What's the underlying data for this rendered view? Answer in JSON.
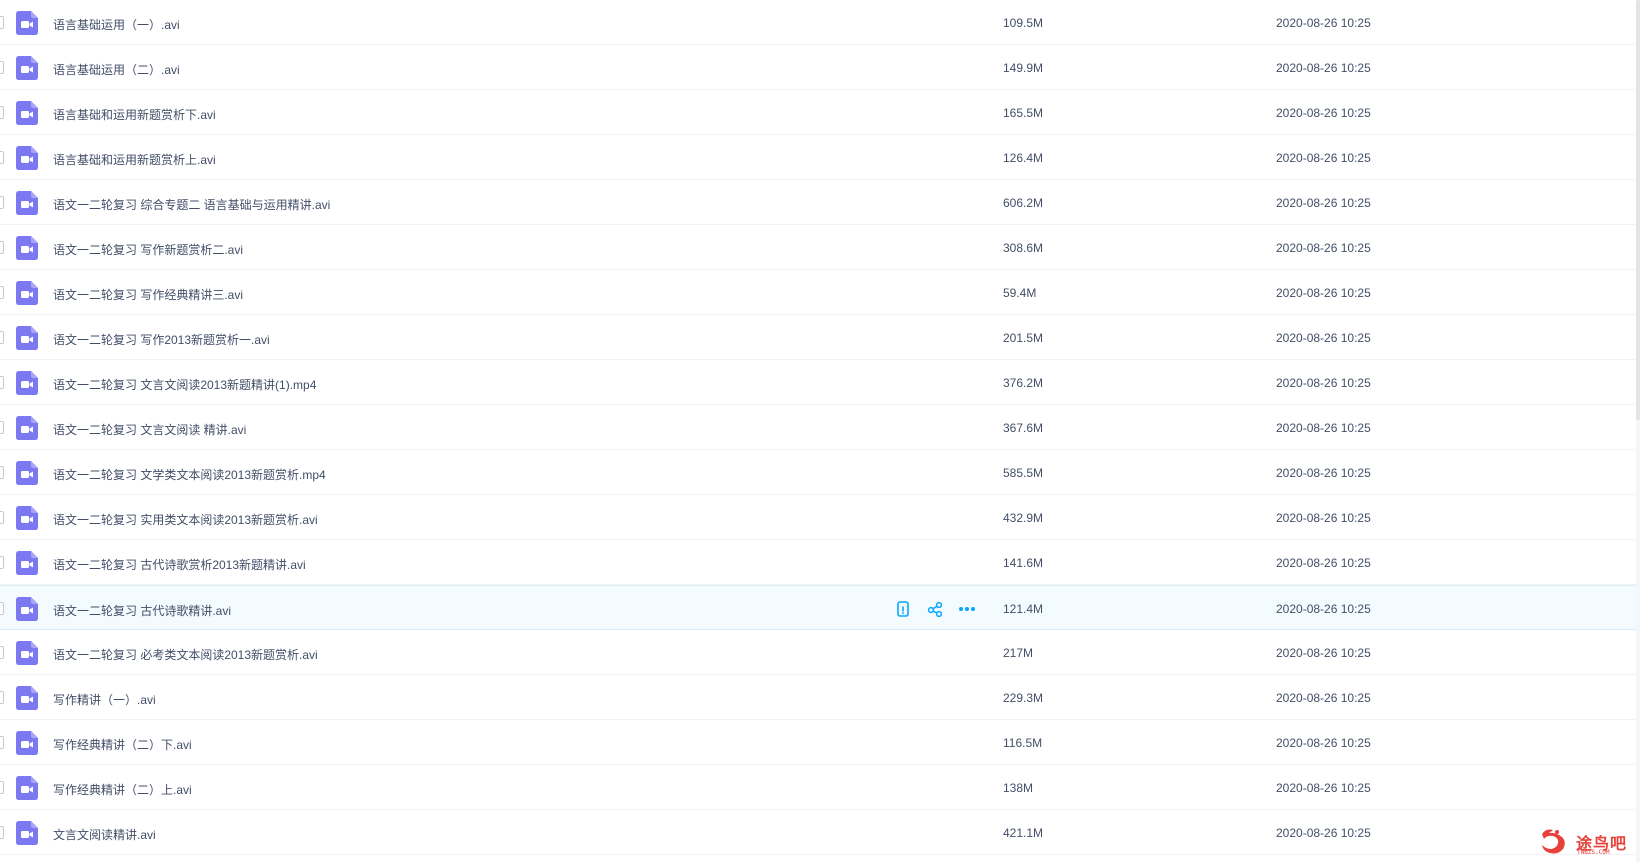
{
  "file_list": {
    "hovered_index": 13,
    "row_actions": {
      "icons": [
        "mobile-phone-icon",
        "share-icon",
        "more-options-icon"
      ]
    },
    "colors": {
      "file_icon": "#7b78f1",
      "action_icon": "#06a7ff",
      "hover_bg": "#f4fbff",
      "text": "#424e67"
    },
    "items": [
      {
        "name": "语言基础运用（一）.avi",
        "size": "109.5M",
        "date": "2020-08-26 10:25"
      },
      {
        "name": "语言基础运用（二）.avi",
        "size": "149.9M",
        "date": "2020-08-26 10:25"
      },
      {
        "name": "语言基础和运用新题赏析下.avi",
        "size": "165.5M",
        "date": "2020-08-26 10:25"
      },
      {
        "name": "语言基础和运用新题赏析上.avi",
        "size": "126.4M",
        "date": "2020-08-26 10:25"
      },
      {
        "name": "语文一二轮复习 综合专题二 语言基础与运用精讲.avi",
        "size": "606.2M",
        "date": "2020-08-26 10:25"
      },
      {
        "name": "语文一二轮复习 写作新题赏析二.avi",
        "size": "308.6M",
        "date": "2020-08-26 10:25"
      },
      {
        "name": "语文一二轮复习 写作经典精讲三.avi",
        "size": "59.4M",
        "date": "2020-08-26 10:25"
      },
      {
        "name": "语文一二轮复习 写作2013新题赏析一.avi",
        "size": "201.5M",
        "date": "2020-08-26 10:25"
      },
      {
        "name": "语文一二轮复习 文言文阅读2013新题精讲(1).mp4",
        "size": "376.2M",
        "date": "2020-08-26 10:25"
      },
      {
        "name": "语文一二轮复习 文言文阅读 精讲.avi",
        "size": "367.6M",
        "date": "2020-08-26 10:25"
      },
      {
        "name": "语文一二轮复习 文学类文本阅读2013新题赏析.mp4",
        "size": "585.5M",
        "date": "2020-08-26 10:25"
      },
      {
        "name": "语文一二轮复习 实用类文本阅读2013新题赏析.avi",
        "size": "432.9M",
        "date": "2020-08-26 10:25"
      },
      {
        "name": "语文一二轮复习 古代诗歌赏析2013新题精讲.avi",
        "size": "141.6M",
        "date": "2020-08-26 10:25"
      },
      {
        "name": "语文一二轮复习 古代诗歌精讲.avi",
        "size": "121.4M",
        "date": "2020-08-26 10:25"
      },
      {
        "name": "语文一二轮复习 必考类文本阅读2013新题赏析.avi",
        "size": "217M",
        "date": "2020-08-26 10:25"
      },
      {
        "name": "写作精讲（一）.avi",
        "size": "229.3M",
        "date": "2020-08-26 10:25"
      },
      {
        "name": "写作经典精讲（二）下.avi",
        "size": "116.5M",
        "date": "2020-08-26 10:25"
      },
      {
        "name": "写作经典精讲（二）上.avi",
        "size": "138M",
        "date": "2020-08-26 10:25"
      },
      {
        "name": "文言文阅读精讲.avi",
        "size": "421.1M",
        "date": "2020-08-26 10:25"
      }
    ]
  },
  "watermark": {
    "text": "途鸟吧",
    "subtext": "TNBZS.COM",
    "color": "#e8403a"
  }
}
